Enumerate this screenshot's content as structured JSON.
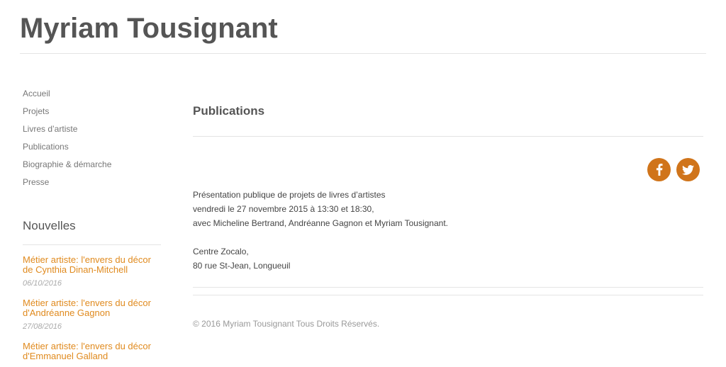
{
  "site": {
    "title": "Myriam Tousignant"
  },
  "sidebar": {
    "menu": [
      {
        "label": "Accueil"
      },
      {
        "label": "Projets"
      },
      {
        "label": "Livres d’artiste"
      },
      {
        "label": "Publications"
      },
      {
        "label": "Biographie & démarche"
      },
      {
        "label": "Presse"
      }
    ],
    "news_title": "Nouvelles",
    "news": [
      {
        "title": "Métier artiste: l'envers du décor de Cynthia Dinan-Mitchell",
        "date": "06/10/2016"
      },
      {
        "title": "Métier artiste: l'envers du décor d'Andréanne Gagnon",
        "date": "27/08/2016"
      },
      {
        "title": "Métier artiste: l'envers du décor d'Emmanuel Galland",
        "date": ""
      }
    ]
  },
  "main": {
    "title": "Publications",
    "share": {
      "facebook_icon": "facebook-icon",
      "twitter_icon": "twitter-icon",
      "color": "#d0741a"
    },
    "content": {
      "line1": "Présentation publique de projets de livres d’artistes",
      "line2": "vendredi le 27 novembre 2015 à 13:30 et 18:30,",
      "line3": "avec Micheline Bertrand, Andréanne Gagnon et Myriam Tousignant.",
      "line4": "Centre Zocalo,",
      "line5": "80 rue St-Jean, Longueuil"
    }
  },
  "footer": {
    "copyright": "© 2016 Myriam Tousignant Tous Droits Réservés."
  },
  "colors": {
    "accent": "#e08a1e",
    "text": "#555555",
    "rule": "#e4e4e4"
  }
}
